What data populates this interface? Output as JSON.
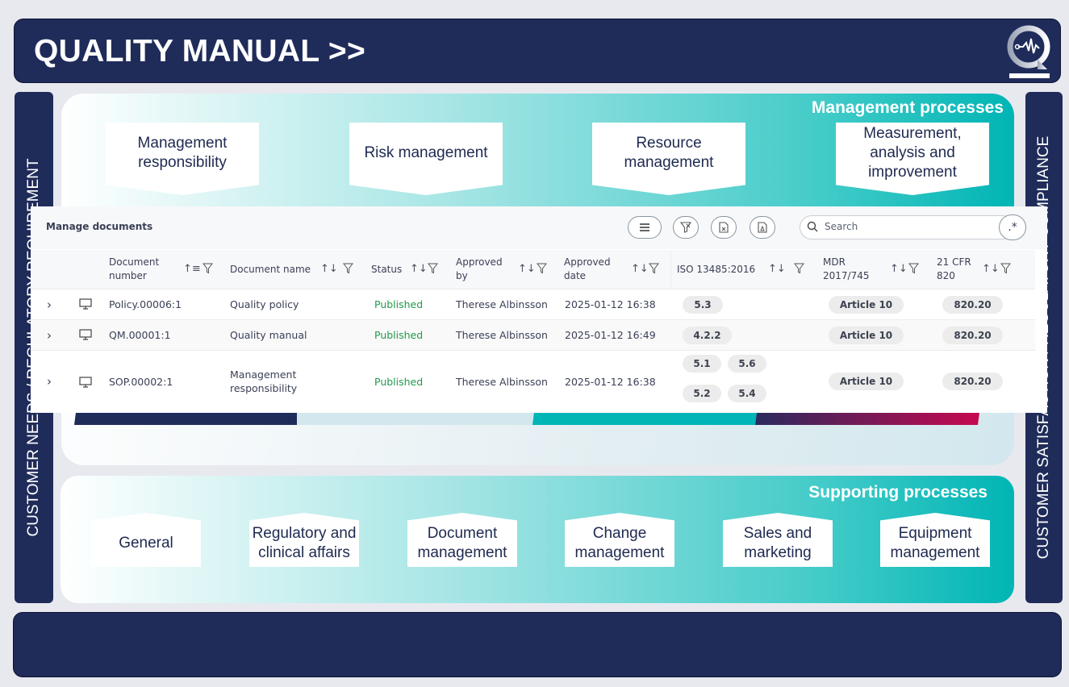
{
  "header": {
    "title": "QUALITY MANUAL >>",
    "logo": "quality-waveform-logo"
  },
  "left_banner": "CUSTOMER NEEDS / REGULATORY REQUIREMENT",
  "right_banner": "CUSTOMER SATISFACTION / REGULATORY COMPLIANCE",
  "management": {
    "label": "Management processes",
    "boxes": [
      "Management responsibility",
      "Risk management",
      "Resource management",
      "Measurement, analysis and improvement"
    ]
  },
  "supporting": {
    "label": "Supporting processes",
    "boxes": [
      "General",
      "Regulatory and clinical affairs",
      "Document management",
      "Change management",
      "Sales and marketing",
      "Equipment management"
    ]
  },
  "stripe_colors": [
    "#1f2c5a",
    "#d2e8ee",
    "#00b5b5",
    "#c8084f"
  ],
  "documents": {
    "title": "Manage documents",
    "toolbar": {
      "icons": [
        "menu-icon",
        "clear-filter-icon",
        "export-excel-icon",
        "export-pdf-icon"
      ],
      "search_placeholder": "Search",
      "regex_label": ".*"
    },
    "columns": [
      {
        "label": "Document number",
        "sort": "ascending"
      },
      {
        "label": "Document name",
        "sort": "none"
      },
      {
        "label": "Status",
        "sort": "none"
      },
      {
        "label": "Approved by",
        "sort": "none"
      },
      {
        "label": "Approved date",
        "sort": "none"
      },
      {
        "label": "ISO 13485:2016",
        "sort": "none"
      },
      {
        "label": "MDR 2017/745",
        "sort": "none"
      },
      {
        "label": "21 CFR 820",
        "sort": "none"
      }
    ],
    "rows": [
      {
        "number": "Policy.00006:1",
        "name": "Quality policy",
        "status": "Published",
        "approved_by": "Therese Albinsson",
        "approved_date": "2025-01-12 16:38",
        "iso": [
          "5.3"
        ],
        "mdr": "Article 10",
        "cfr": "820.20"
      },
      {
        "number": "QM.00001:1",
        "name": "Quality manual",
        "status": "Published",
        "approved_by": "Therese Albinsson",
        "approved_date": "2025-01-12 16:49",
        "iso": [
          "4.2.2"
        ],
        "mdr": "Article 10",
        "cfr": "820.20"
      },
      {
        "number": "SOP.00002:1",
        "name": "Management responsibility",
        "status": "Published",
        "approved_by": "Therese Albinsson",
        "approved_date": "2025-01-12 16:38",
        "iso": [
          "5.1",
          "5.6",
          "5.2",
          "5.4"
        ],
        "mdr": "Article 10",
        "cfr": "820.20"
      }
    ],
    "status_color": "#1e9a4a"
  }
}
